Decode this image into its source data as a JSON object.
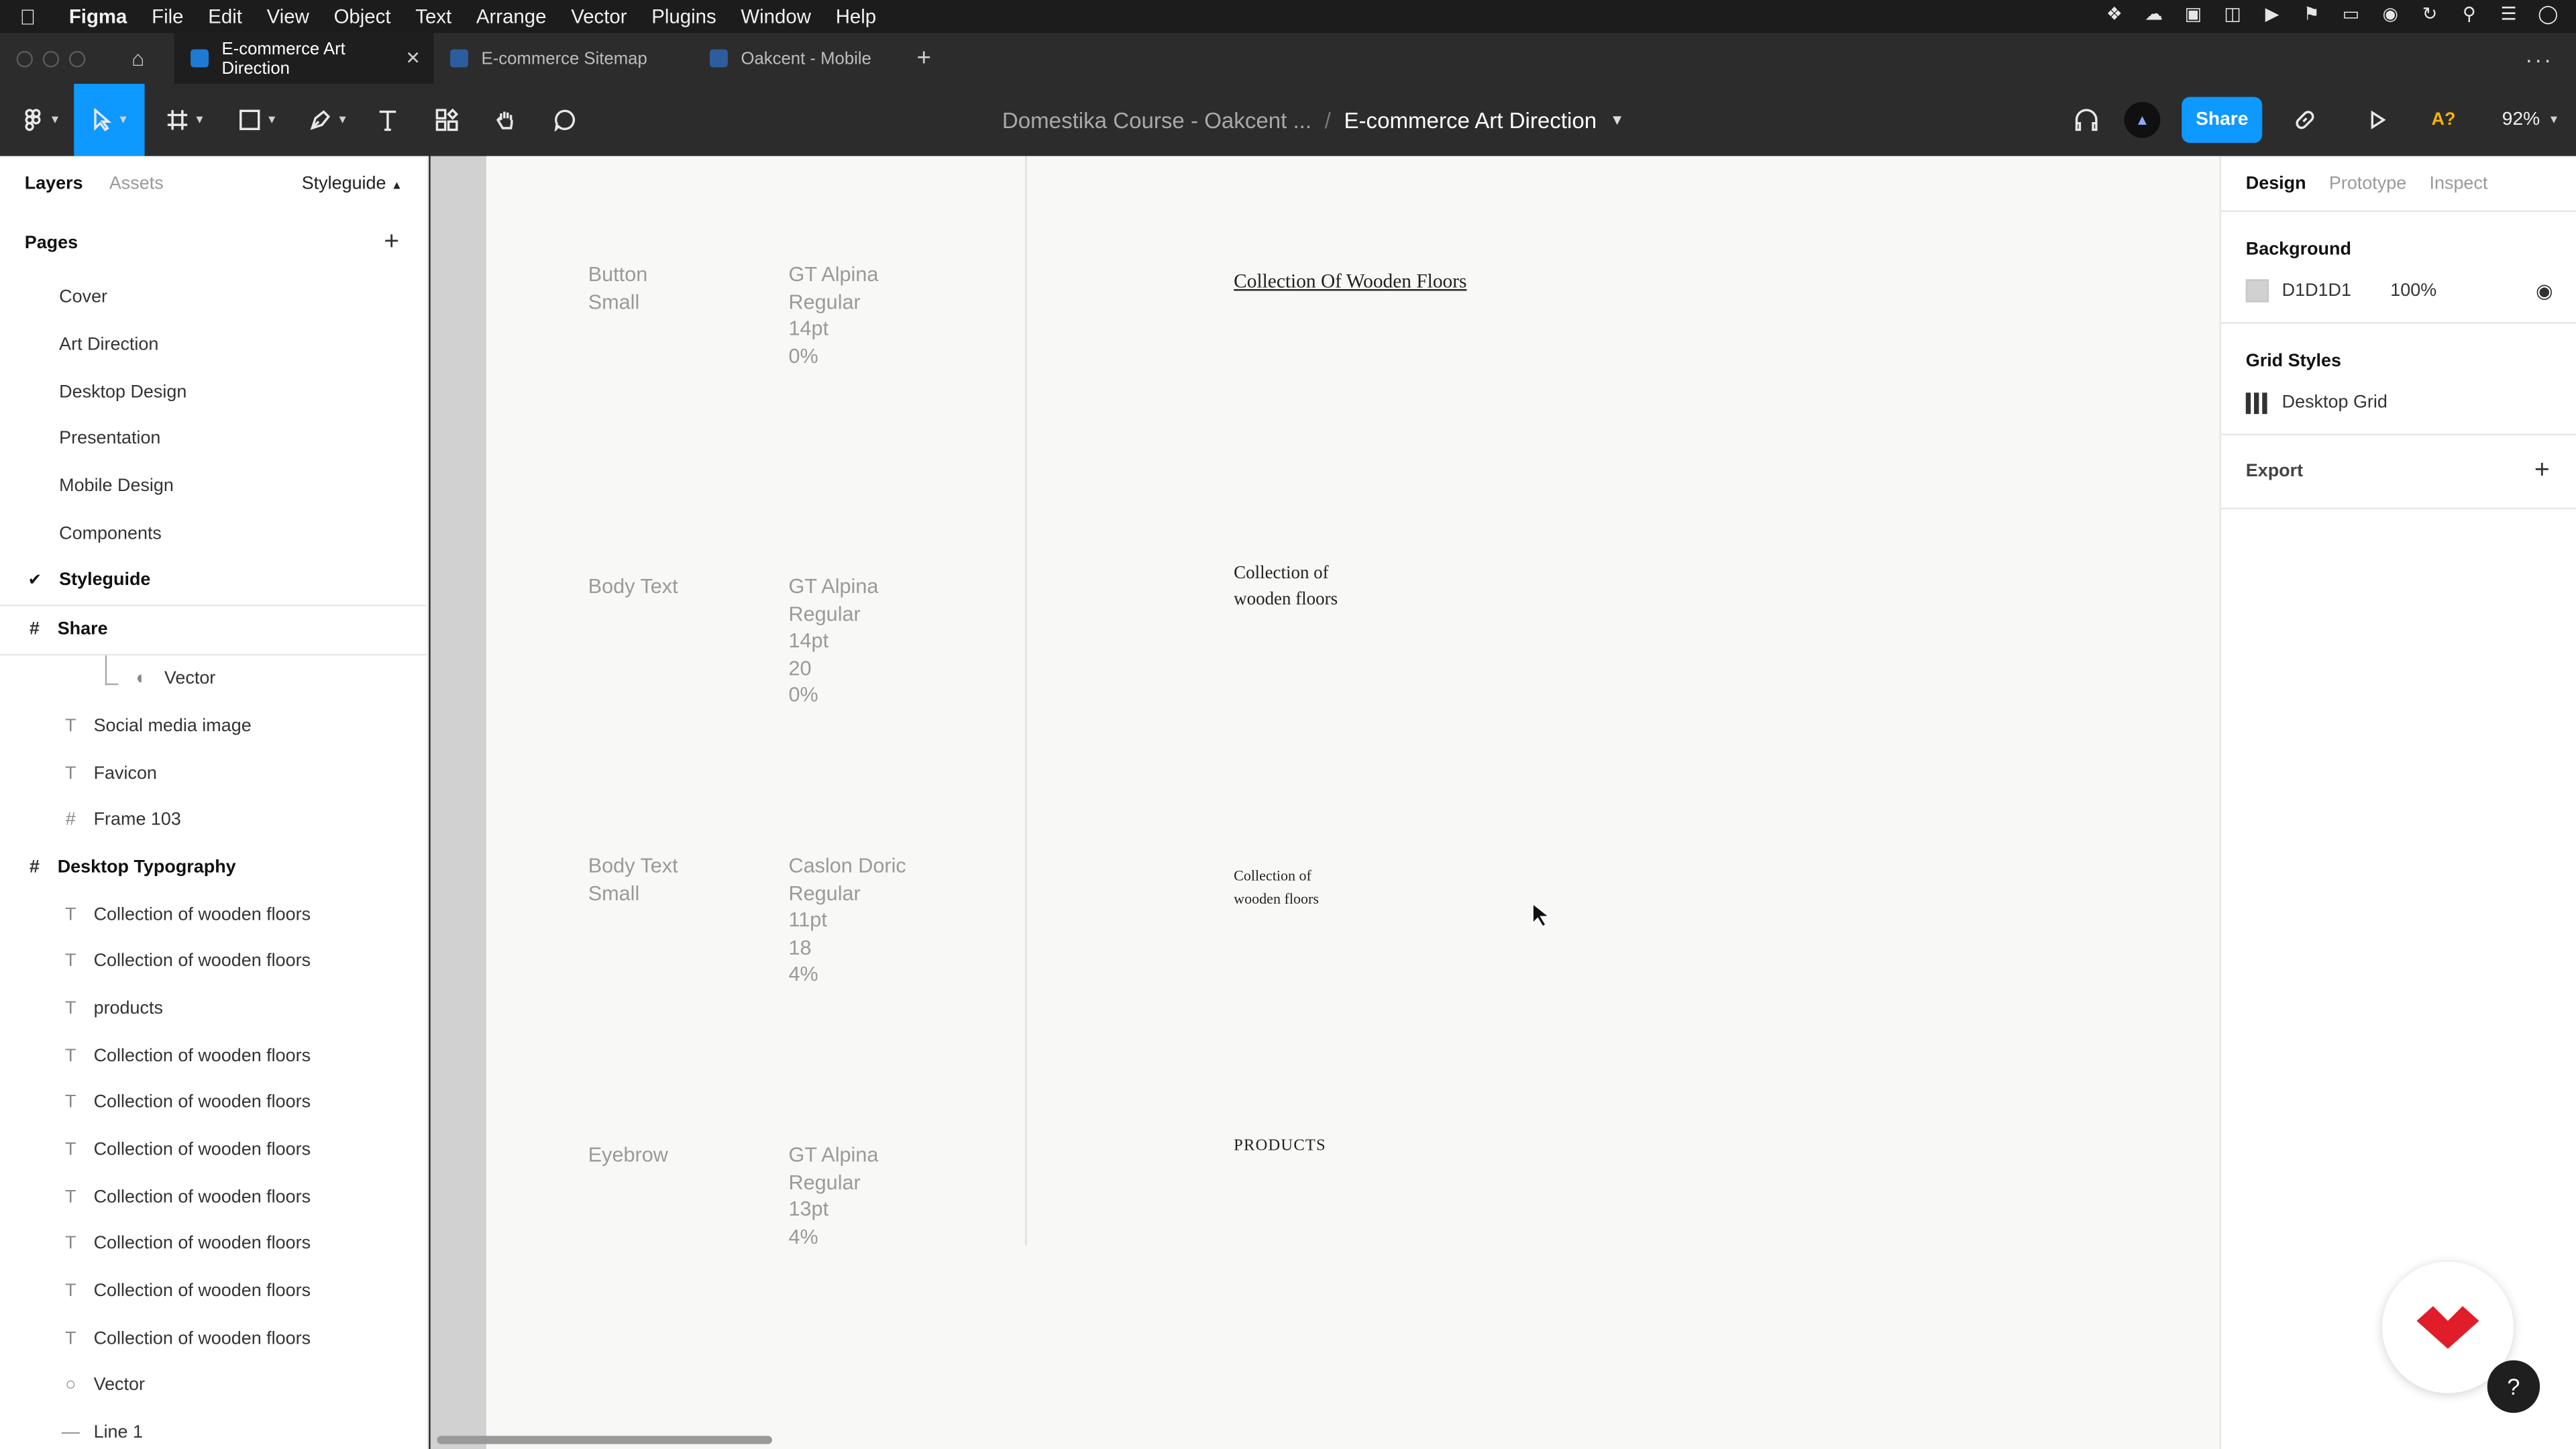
{
  "menubar": {
    "app": "Figma",
    "items": [
      "File",
      "Edit",
      "View",
      "Object",
      "Text",
      "Arrange",
      "Vector",
      "Plugins",
      "Window",
      "Help"
    ]
  },
  "tabs": [
    {
      "label": "E-commerce Art Direction",
      "active": true
    },
    {
      "label": "E-commerce Sitemap",
      "active": false
    },
    {
      "label": "Oakcent - Mobile",
      "active": false
    }
  ],
  "toolbar": {
    "breadcrumb_project": "Domestika Course - Oakcent ...",
    "breadcrumb_separator": "/",
    "breadcrumb_file": "E-commerce Art Direction",
    "share_label": "Share",
    "missing_fonts_label": "A?",
    "zoom": "92%"
  },
  "left_panel": {
    "tab_layers": "Layers",
    "tab_assets": "Assets",
    "page_selector": "Styleguide",
    "pages_title": "Pages",
    "pages": [
      "Cover",
      "Art Direction",
      "Desktop Design",
      "Presentation",
      "Mobile Design",
      "Components",
      "Styleguide"
    ],
    "current_page": "Styleguide",
    "layers": [
      {
        "label": "Share",
        "icon": "frame-icon",
        "kind": "frame",
        "indent": 0
      },
      {
        "label": "Vector",
        "icon": "boolean-icon",
        "kind": "child",
        "indent": 2
      },
      {
        "label": "Social media image",
        "icon": "text-icon",
        "kind": "child",
        "indent": 1
      },
      {
        "label": "Favicon",
        "icon": "text-icon",
        "kind": "child",
        "indent": 1
      },
      {
        "label": "Frame 103",
        "icon": "frame-icon",
        "kind": "child",
        "indent": 1
      },
      {
        "label": "Desktop Typography",
        "icon": "frame-icon",
        "kind": "frame",
        "indent": 0
      },
      {
        "label": "Collection of wooden floors",
        "icon": "text-icon",
        "kind": "child",
        "indent": 1
      },
      {
        "label": "Collection of wooden floors",
        "icon": "text-icon",
        "kind": "child",
        "indent": 1
      },
      {
        "label": "products",
        "icon": "text-icon",
        "kind": "child",
        "indent": 1
      },
      {
        "label": "Collection of wooden floors",
        "icon": "text-icon",
        "kind": "child",
        "indent": 1
      },
      {
        "label": "Collection of wooden floors",
        "icon": "text-icon",
        "kind": "child",
        "indent": 1
      },
      {
        "label": "Collection of wooden floors",
        "icon": "text-icon",
        "kind": "child",
        "indent": 1
      },
      {
        "label": "Collection of wooden floors",
        "icon": "text-icon",
        "kind": "child",
        "indent": 1
      },
      {
        "label": "Collection of wooden floors",
        "icon": "text-icon",
        "kind": "child",
        "indent": 1
      },
      {
        "label": "Collection of wooden floors",
        "icon": "text-icon",
        "kind": "child",
        "indent": 1
      },
      {
        "label": "Collection of wooden floors",
        "icon": "text-icon",
        "kind": "child",
        "indent": 1
      },
      {
        "label": "Vector",
        "icon": "ellipse-icon",
        "kind": "child",
        "indent": 1
      },
      {
        "label": "Line 1",
        "icon": "line-icon",
        "kind": "child",
        "indent": 1
      }
    ]
  },
  "canvas": {
    "specs": [
      {
        "label": "Button\nSmall",
        "values": [
          "GT Alpina",
          "Regular",
          "14pt",
          "0%"
        ],
        "sample": "Collection Of Wooden Floors",
        "style": "s1"
      },
      {
        "label": "Body Text",
        "values": [
          "GT Alpina",
          "Regular",
          "14pt",
          "20",
          "0%"
        ],
        "sample": "Collection of\nwooden floors",
        "style": "s2"
      },
      {
        "label": "Body Text\nSmall",
        "values": [
          "Caslon Doric",
          "Regular",
          "11pt",
          "18",
          "4%"
        ],
        "sample": "Collection of\nwooden floors",
        "style": "s3"
      },
      {
        "label": "Eyebrow",
        "values": [
          "GT Alpina",
          "Regular",
          "13pt",
          "4%"
        ],
        "sample": "PRODUCTS",
        "style": "s4"
      }
    ]
  },
  "right_panel": {
    "tab_design": "Design",
    "tab_prototype": "Prototype",
    "tab_inspect": "Inspect",
    "background_title": "Background",
    "background_hex": "D1D1D1",
    "background_opacity": "100%",
    "background_color": "#D1D1D1",
    "grid_styles_title": "Grid Styles",
    "grid_style_name": "Desktop Grid",
    "export_title": "Export"
  },
  "help_label": "?"
}
